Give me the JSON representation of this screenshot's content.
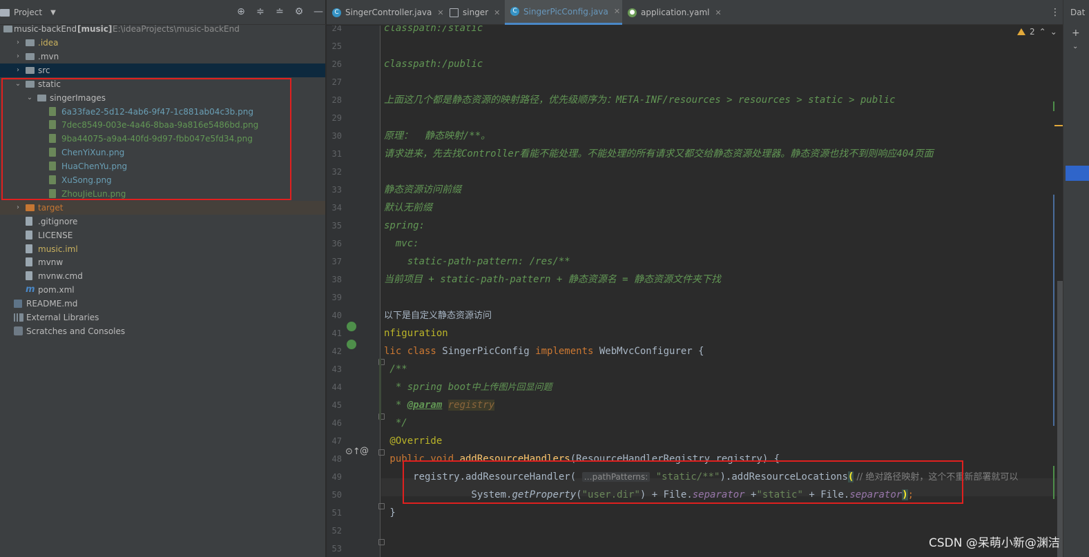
{
  "project_panel": {
    "title": "Project",
    "root": {
      "name": "music-backEnd",
      "module": "[music]",
      "path": "E:\\ideaProjects\\music-backEnd"
    },
    "tree": [
      {
        "label": ".idea",
        "color": "#c9b15e",
        "icon": "folder",
        "expanded": false
      },
      {
        "label": ".mvn",
        "color": "#bbbbbb",
        "icon": "folder",
        "expanded": false
      },
      {
        "label": "src",
        "color": "#bbbbbb",
        "icon": "folder",
        "expanded": false,
        "selected": true
      },
      {
        "label": "static",
        "color": "#bbbbbb",
        "icon": "folder",
        "expanded": true
      },
      {
        "label": "singerImages",
        "color": "#bbbbbb",
        "icon": "folder",
        "expanded": true
      },
      {
        "label": "6a33fae2-5d12-4ab6-9f47-1c881ab04c3b.png",
        "color": "#6a9fb5",
        "icon": "image"
      },
      {
        "label": "7dec8549-003e-4a46-8baa-9a816e5486bd.png",
        "color": "#629755",
        "icon": "image"
      },
      {
        "label": "9ba44075-a9a4-40fd-9d97-fbb047e5fd34.png",
        "color": "#629755",
        "icon": "image"
      },
      {
        "label": "ChenYiXun.png",
        "color": "#6a9fb5",
        "icon": "image"
      },
      {
        "label": "HuaChenYu.png",
        "color": "#6a9fb5",
        "icon": "image"
      },
      {
        "label": "XuSong.png",
        "color": "#6a9fb5",
        "icon": "image"
      },
      {
        "label": "ZhouJieLun.png",
        "color": "#629755",
        "icon": "image"
      },
      {
        "label": "target",
        "color": "#c57633",
        "icon": "folder-orange",
        "expanded": false
      },
      {
        "label": ".gitignore",
        "color": "#bbbbbb",
        "icon": "file"
      },
      {
        "label": "LICENSE",
        "color": "#bbbbbb",
        "icon": "file"
      },
      {
        "label": "music.iml",
        "color": "#c9b15e",
        "icon": "file"
      },
      {
        "label": "mvnw",
        "color": "#bbbbbb",
        "icon": "file"
      },
      {
        "label": "mvnw.cmd",
        "color": "#bbbbbb",
        "icon": "file"
      },
      {
        "label": "pom.xml",
        "color": "#bbbbbb",
        "icon": "maven"
      },
      {
        "label": "README.md",
        "color": "#bbbbbb",
        "icon": "markdown"
      },
      {
        "label": "External Libraries",
        "color": "#bbbbbb",
        "icon": "library"
      },
      {
        "label": "Scratches and Consoles",
        "color": "#bbbbbb",
        "icon": "scratch"
      }
    ]
  },
  "tabs": [
    {
      "label": "SingerController.java",
      "icon": "java-class-icon",
      "active": false
    },
    {
      "label": "singer",
      "icon": "table-icon",
      "active": false
    },
    {
      "label": "SingerPicConfig.java",
      "icon": "java-class-icon",
      "active": true
    },
    {
      "label": "application.yaml",
      "icon": "yaml-icon",
      "active": false
    }
  ],
  "right_strip": {
    "label": "Dat"
  },
  "editor": {
    "warning_count": "2",
    "line_numbers": [
      "24",
      "25",
      "26",
      "27",
      "28",
      "29",
      "30",
      "31",
      "32",
      "33",
      "34",
      "35",
      "36",
      "37",
      "38",
      "39",
      "40",
      "41",
      "42",
      "43",
      "44",
      "45",
      "46",
      "47",
      "48",
      "49",
      "50",
      "51",
      "52",
      "53"
    ],
    "lines": {
      "l24": "classpath:/static",
      "l26": "classpath:/public",
      "l28": "上面这几个都是静态资源的映射路径，优先级顺序为：META-INF/resources > resources > static > public",
      "l30": "原理：  静态映射/**。",
      "l31": "请求进来，先去找Controller看能不能处理。不能处理的所有请求又都交给静态资源处理器。静态资源也找不到则响应404页面",
      "l33": "静态资源访问前缀",
      "l34": "默认无前缀",
      "l35": "spring:",
      "l36": "  mvc:",
      "l37": "    static-path-pattern: /res/**",
      "l38": "当前项目 + static-path-pattern + 静态资源名 = 静态资源文件夹下找",
      "l40": "以下是自定义静态资源访问",
      "l41": "nfiguration",
      "l42_kw": "lic class ",
      "l42_name": "SingerPicConfig ",
      "l42_impl": "implements ",
      "l42_rest": "WebMvcConfigurer {",
      "l43": " /**",
      "l44_a": "  * spring boot",
      "l44_b": "中上传图片回显问题",
      "l45_a": "  * ",
      "l45_tag": "@param",
      "l45_param": "registry",
      "l46": "  */",
      "l47": " @Override",
      "l48_kw": " public void ",
      "l48_fn": "addResourceHandlers",
      "l48_rest": "(ResourceHandlerRegistry registry) {",
      "l49_a": "     registry.addResourceHandler( ",
      "l49_hint": "…pathPatterns:",
      "l49_str": " \"static/**\"",
      "l49_b": ").addResourceLocations",
      "l49_paren": "(",
      "l49_comment": " // 绝对路径映射，这个不重新部署就可以",
      "l50_a": "               System.",
      "l50_getprop": "getProperty",
      "l50_b": "(",
      "l50_str1": "\"user.dir\"",
      "l50_c": ") + File.",
      "l50_sep1": "separator",
      "l50_d": " +",
      "l50_str2": "\"static\"",
      "l50_e": " + File.",
      "l50_sep2": "separator",
      "l50_paren": ")",
      "l50_semi": ";",
      "l51": " }"
    }
  },
  "watermark": "CSDN @呆萌小新@渊洁"
}
